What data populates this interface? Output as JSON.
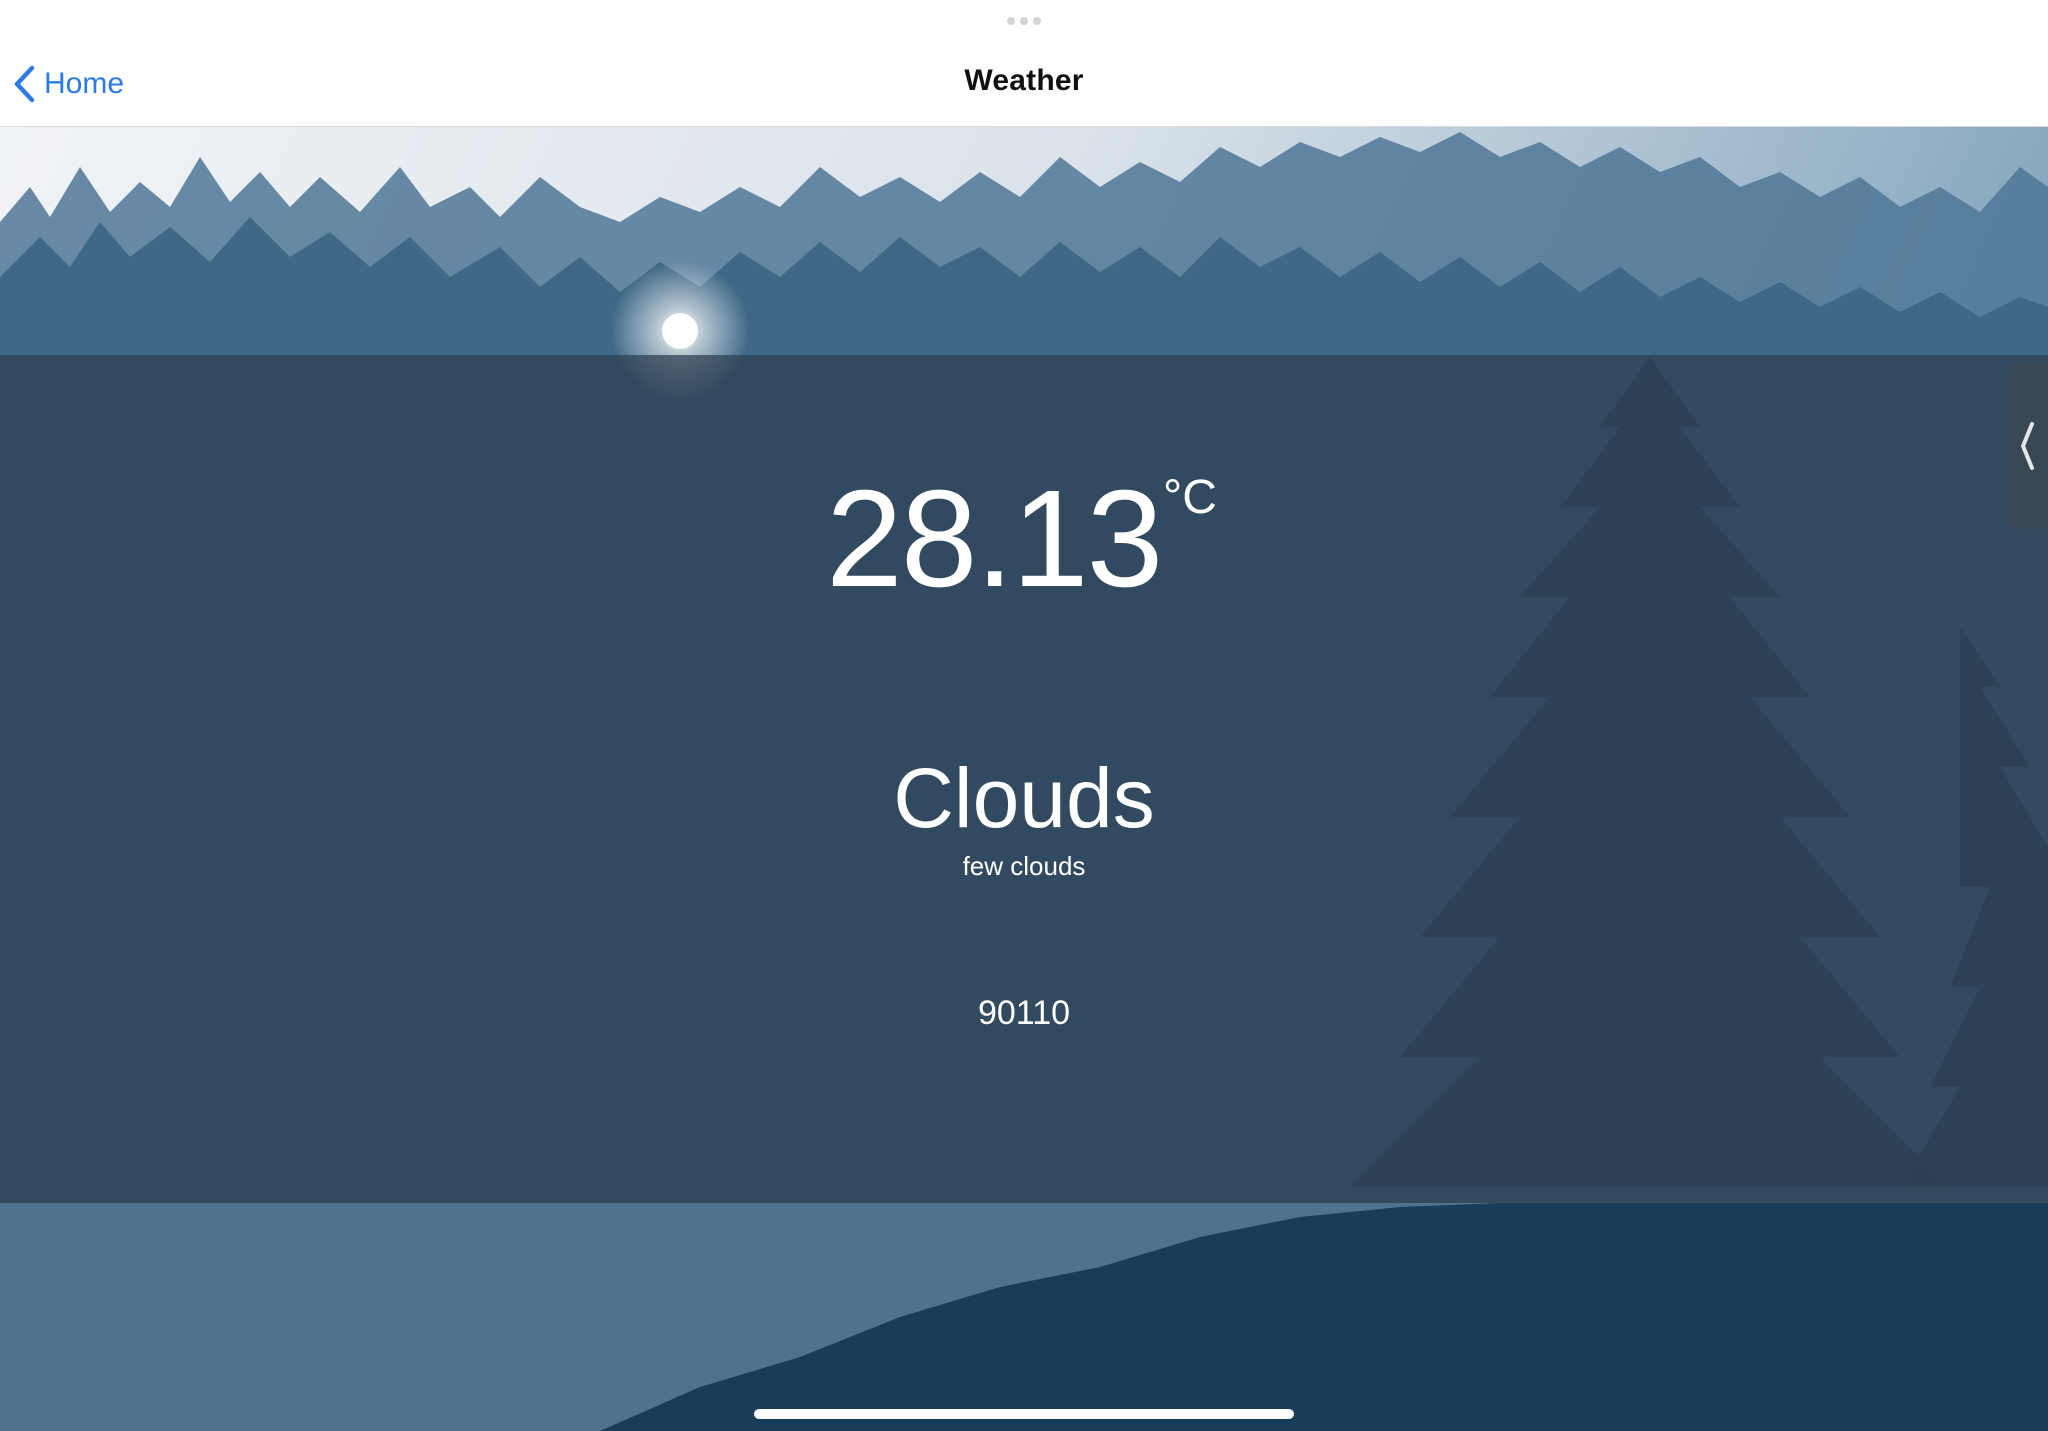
{
  "navbar": {
    "back_label": "Home",
    "title": "Weather"
  },
  "weather": {
    "temperature": "28.13",
    "unit": "°C",
    "condition": "Clouds",
    "description": "few clouds",
    "zip": "90110"
  },
  "icons": {
    "back": "chevron-left-icon",
    "side_handle": "chevron-left-icon",
    "multitask": "ellipsis-icon"
  },
  "colors": {
    "accent": "#2c7be5",
    "card_overlay": "#2e3e50",
    "sky_top": "#eef1f4",
    "forest_dark": "#183d58"
  }
}
